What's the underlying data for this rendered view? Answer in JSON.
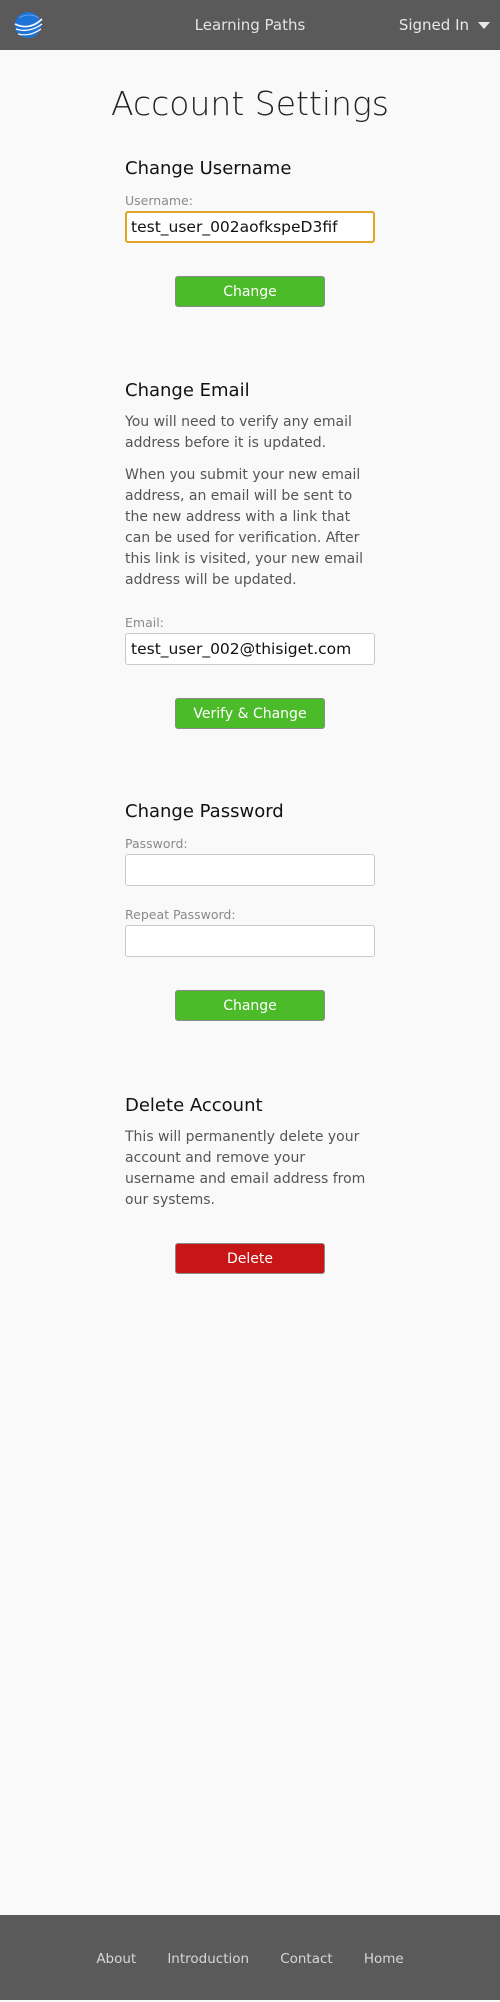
{
  "header": {
    "nav_title": "Learning Paths",
    "user_menu_label": "Signed In"
  },
  "page": {
    "title": "Account Settings"
  },
  "change_username": {
    "heading": "Change Username",
    "label": "Username:",
    "value": "test_user_002aofkspeD3fif",
    "button": "Change"
  },
  "change_email": {
    "heading": "Change Email",
    "note1": "You will need to verify any email address before it is updated.",
    "note2": "When you submit your new email address, an email will be sent to the new address with a link that can be used for verification. After this link is visited, your new email address will be updated.",
    "label": "Email:",
    "value": "test_user_002@thisiget.com",
    "button": "Verify & Change"
  },
  "change_password": {
    "heading": "Change Password",
    "password_label": "Password:",
    "password_value": "",
    "repeat_label": "Repeat Password:",
    "repeat_value": "",
    "button": "Change"
  },
  "delete_account": {
    "heading": "Delete Account",
    "note": "This will permanently delete your account and remove your username and email address from our systems.",
    "button": "Delete"
  },
  "footer": {
    "links": [
      "About",
      "Introduction",
      "Contact",
      "Home"
    ]
  },
  "colors": {
    "accent_green": "#4cbb2a",
    "danger_red": "#c81515",
    "focus_orange": "#e0a526",
    "bar_gray": "#5a5a5a",
    "logo_blue": "#1e73d6"
  },
  "icons": {
    "logo": "globe-logo-icon",
    "user_menu": "chevron-down-icon"
  }
}
